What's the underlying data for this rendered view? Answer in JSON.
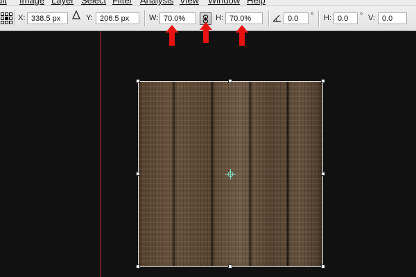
{
  "menu": {
    "items": [
      "dit",
      "Image",
      "Layer",
      "Select",
      "Filter",
      "Analysis",
      "View",
      "Window",
      "Help"
    ]
  },
  "options": {
    "x_label": "X:",
    "x_value": "338.5 px",
    "y_label": "Y:",
    "y_value": "206.5 px",
    "w_label": "W:",
    "w_value": "70.0%",
    "h_label": "H:",
    "h_value": "70.0%",
    "rotate_value": "0.0",
    "rotate_unit": "°",
    "hskew_label": "H:",
    "hskew_value": "0.0",
    "hskew_unit": "°",
    "vskew_label": "V:",
    "vskew_value": "0.0"
  },
  "icons": {
    "reference_point": "reference-point-icon",
    "delta": "delta-icon",
    "link": "link-icon",
    "rotate": "rotate-angle-icon",
    "annotation_arrow": "arrow-up-icon"
  },
  "colors": {
    "annotation_arrow": "#e81212",
    "guide": "#c0353b",
    "canvas": "#111111"
  }
}
